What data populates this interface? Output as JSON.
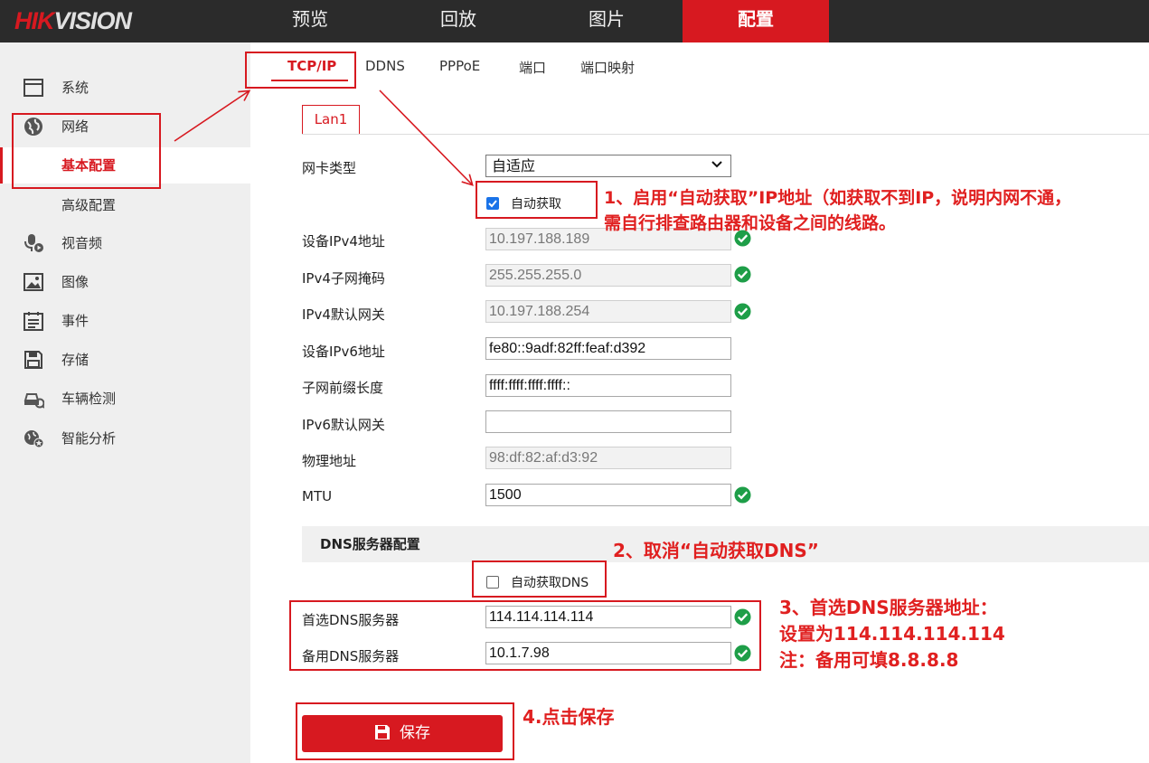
{
  "brand": {
    "hik": "HIK",
    "vision": "VISION"
  },
  "nav": {
    "tabs": [
      {
        "label": "预览"
      },
      {
        "label": "回放"
      },
      {
        "label": "图片"
      },
      {
        "label": "配置"
      }
    ],
    "active": "配置"
  },
  "sidebar": {
    "items": [
      {
        "label": "系统",
        "icon": "window-icon"
      },
      {
        "label": "网络",
        "icon": "globe-icon"
      },
      {
        "label": "基本配置",
        "sub": true,
        "selected": true
      },
      {
        "label": "高级配置",
        "sub": true
      },
      {
        "label": "视音频",
        "icon": "microphone-icon"
      },
      {
        "label": "图像",
        "icon": "image-icon"
      },
      {
        "label": "事件",
        "icon": "event-list-icon"
      },
      {
        "label": "存储",
        "icon": "save-disk-icon"
      },
      {
        "label": "车辆检测",
        "icon": "vehicle-detect-icon"
      },
      {
        "label": "智能分析",
        "icon": "smart-analysis-icon"
      }
    ]
  },
  "subtabs": {
    "items": [
      {
        "label": "TCP/IP"
      },
      {
        "label": "DDNS"
      },
      {
        "label": "PPPoE"
      },
      {
        "label": "端口"
      },
      {
        "label": "端口映射"
      }
    ],
    "active": "TCP/IP"
  },
  "lan_tab": "Lan1",
  "form": {
    "nic_type": {
      "label": "网卡类型",
      "value": "自适应"
    },
    "dhcp": {
      "label": "自动获取",
      "checked": true
    },
    "ipv4_addr": {
      "label": "设备IPv4地址",
      "value": "10.197.188.189"
    },
    "ipv4_mask": {
      "label": "IPv4子网掩码",
      "value": "255.255.255.0"
    },
    "ipv4_gw": {
      "label": "IPv4默认网关",
      "value": "10.197.188.254"
    },
    "ipv6_addr": {
      "label": "设备IPv6地址",
      "value": "fe80::9adf:82ff:feaf:d392"
    },
    "ipv6_prefix": {
      "label": "子网前缀长度",
      "value": "ffff:ffff:ffff:ffff::"
    },
    "ipv6_gw": {
      "label": "IPv6默认网关",
      "value": ""
    },
    "mac": {
      "label": "物理地址",
      "value": "98:df:82:af:d3:92"
    },
    "mtu": {
      "label": "MTU",
      "value": "1500"
    }
  },
  "dns": {
    "header": "DNS服务器配置",
    "auto": {
      "label": "自动获取DNS",
      "checked": false
    },
    "primary": {
      "label": "首选DNS服务器",
      "value": "114.114.114.114"
    },
    "secondary": {
      "label": "备用DNS服务器",
      "value": "10.1.7.98"
    }
  },
  "save_label": "保存",
  "annotations": {
    "a1_line1": "1、启用“自动获取”IP地址（如获取不到IP，说明内网不通，",
    "a1_line2": "需自行排查路由器和设备之间的线路。",
    "a2": "2、取消“自动获取DNS”",
    "a3_line1": "3、首选DNS服务器地址：",
    "a3_line2": "设置为114.114.114.114",
    "a3_line3": "注：备用可填8.8.8.8",
    "a4": "4.点击保存"
  },
  "colors": {
    "accent": "#d71920",
    "topbar": "#2b2b2b",
    "sidebar": "#efefef",
    "ok": "#1e9e48",
    "annotation": "#e02020"
  }
}
